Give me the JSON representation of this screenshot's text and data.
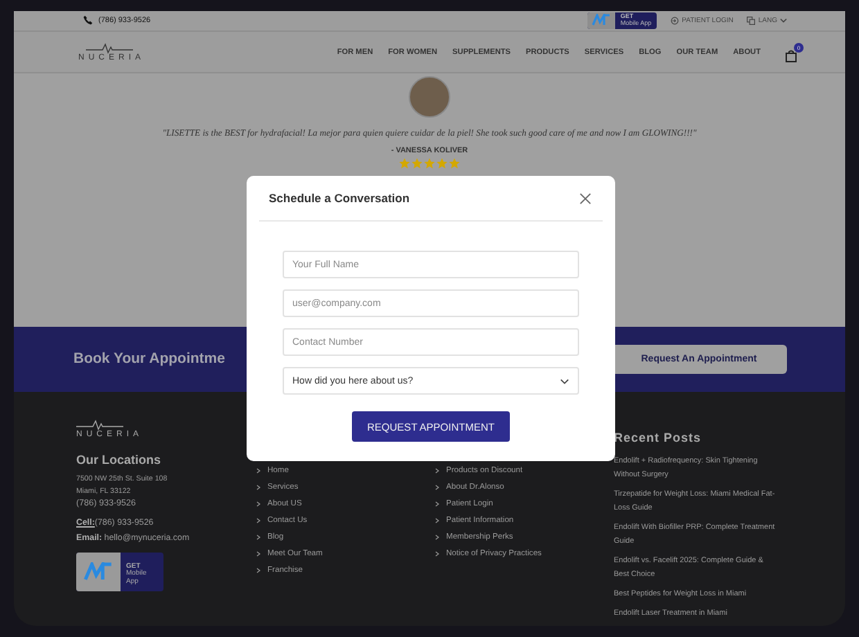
{
  "top_bar": {
    "phone": "(786) 933-9526",
    "app_badge": {
      "line_1": "GET",
      "line_2": "Mobile App"
    },
    "patient_login": "PATIENT LOGIN",
    "language": "LANG"
  },
  "nav": {
    "logo": "NUCERIA",
    "items": [
      "FOR MEN",
      "FOR WOMEN",
      "SUPPLEMENTS",
      "PRODUCTS",
      "SERVICES",
      "BLOG",
      "OUR TEAM",
      "ABOUT"
    ],
    "cart_count": "0"
  },
  "testimonial": {
    "quote": "\"LISETTE is the BEST for hydrafacial! La mejor para quien quiere cuidar de la piel! She took such good care of me and now I am GLOWING!!!\"",
    "author": "- VANESSA KOLIVER",
    "stars": 5
  },
  "booking_band": {
    "title": "Book Your Appointme",
    "button": "Request An Appointment"
  },
  "footer": {
    "logo": "NUCERIA",
    "locations_title": "Our Locations",
    "address_lines": [
      "7500 NW 25th St. Suite 108",
      "Miami, FL 33122",
      "(786) 933-9526"
    ],
    "cell_label": "Cell:",
    "cell": "(786) 933-9526",
    "email_label": "Email:",
    "email": "hello@mynuceria.com",
    "app_badge": {
      "line_1": "GET",
      "line_2": "Mobile App"
    },
    "links_1": [
      "Home",
      "Services",
      "About US",
      "Contact Us",
      "Blog",
      "Meet Our Team",
      "Franchise"
    ],
    "links_2": [
      "Products on Discount",
      "About Dr.Alonso",
      "Patient Login",
      "Patient Information",
      "Membership Perks",
      "Notice of Privacy Practices"
    ],
    "recent_posts_title": "Recent Posts",
    "recent_posts": [
      "Endolift + Radiofrequency: Skin Tightening Without Surgery",
      "Tirzepatide for Weight Loss: Miami Medical Fat-Loss Guide",
      "Endolift With Biofiller PRP: Complete Treatment Guide",
      "Endolift vs. Facelift 2025: Complete Guide & Best Choice",
      "Best Peptides for Weight Loss in Miami",
      "Endolift Laser Treatment in Miami"
    ]
  },
  "modal": {
    "title": "Schedule a Conversation",
    "fields": [
      {
        "kind": "text",
        "placeholder": "Your Full Name"
      },
      {
        "kind": "text",
        "placeholder": "user@company.com"
      },
      {
        "kind": "text",
        "placeholder": "Contact Number"
      },
      {
        "kind": "select",
        "value": "How did you here about us?"
      }
    ],
    "submit": "REQUEST APPOINTMENT"
  }
}
